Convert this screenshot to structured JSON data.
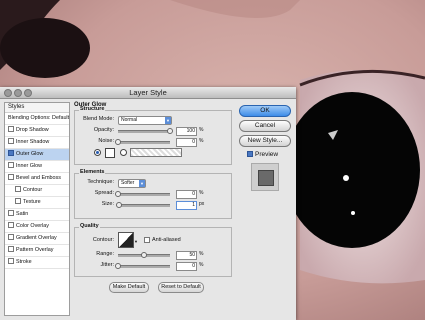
{
  "dialog": {
    "title": "Layer Style",
    "sidebar": {
      "header": "Styles",
      "blending": "Blending Options: Default",
      "items": [
        {
          "label": "Drop Shadow",
          "checked": false
        },
        {
          "label": "Inner Shadow",
          "checked": false
        },
        {
          "label": "Outer Glow",
          "checked": true,
          "selected": true
        },
        {
          "label": "Inner Glow",
          "checked": false
        },
        {
          "label": "Bevel and Emboss",
          "checked": false
        },
        {
          "label": "Contour",
          "checked": false,
          "indent": true
        },
        {
          "label": "Texture",
          "checked": false,
          "indent": true
        },
        {
          "label": "Satin",
          "checked": false
        },
        {
          "label": "Color Overlay",
          "checked": false
        },
        {
          "label": "Gradient Overlay",
          "checked": false
        },
        {
          "label": "Pattern Overlay",
          "checked": false
        },
        {
          "label": "Stroke",
          "checked": false
        }
      ]
    },
    "panel": {
      "title": "Outer Glow",
      "structure": {
        "title": "Structure",
        "blend_mode_label": "Blend Mode:",
        "blend_mode": "Normal",
        "opacity_label": "Opacity:",
        "opacity": "100",
        "noise_label": "Noise:",
        "noise": "0",
        "unit_pct": "%",
        "opacity_level": 1.0,
        "noise_level": 0.0
      },
      "elements": {
        "title": "Elements",
        "technique_label": "Technique:",
        "technique": "Softer",
        "spread_label": "Spread:",
        "spread": "0",
        "size_label": "Size:",
        "size": "1",
        "unit_pct": "%",
        "unit_px": "px",
        "spread_level": 0.0,
        "size_level": 0.01
      },
      "quality": {
        "title": "Quality",
        "contour_label": "Contour:",
        "anti_aliased_label": "Anti-aliased",
        "range_label": "Range:",
        "range": "50",
        "jitter_label": "Jitter:",
        "jitter": "0",
        "unit_pct": "%",
        "range_level": 0.5,
        "jitter_level": 0.0
      },
      "make_default": "Make Default",
      "reset_default": "Reset to Default"
    },
    "buttons": {
      "ok": "OK",
      "cancel": "Cancel",
      "new_style": "New Style...",
      "preview": "Preview"
    }
  }
}
